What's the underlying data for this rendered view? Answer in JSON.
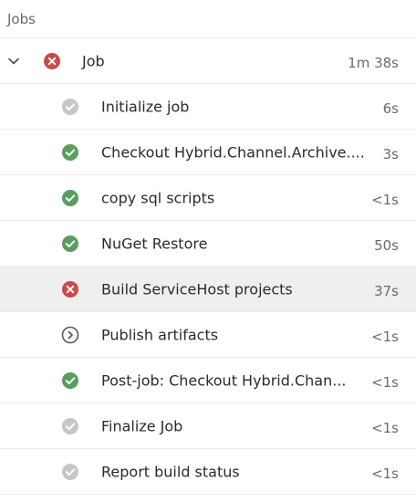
{
  "header": {
    "title": "Jobs"
  },
  "colors": {
    "success": "#5a9e5f",
    "failed": "#c84b4b",
    "skipped": "#c6c6c6",
    "pending_outline": "#5a5a5a",
    "selected_row": "#efefef"
  },
  "job": {
    "label": "Job",
    "duration": "1m 38s",
    "status": "failed",
    "icon": "failed-icon"
  },
  "steps": [
    {
      "label": "Initialize job",
      "duration": "6s",
      "status": "skipped"
    },
    {
      "label": "Checkout Hybrid.Channel.Archive....",
      "duration": "3s",
      "status": "success"
    },
    {
      "label": "copy sql scripts",
      "duration": "<1s",
      "status": "success"
    },
    {
      "label": "NuGet Restore",
      "duration": "50s",
      "status": "success"
    },
    {
      "label": "Build ServiceHost projects",
      "duration": "37s",
      "status": "failed",
      "selected": true
    },
    {
      "label": "Publish artifacts",
      "duration": "<1s",
      "status": "pending"
    },
    {
      "label": "Post-job: Checkout Hybrid.Chan...",
      "duration": "<1s",
      "status": "success"
    },
    {
      "label": "Finalize Job",
      "duration": "<1s",
      "status": "skipped"
    },
    {
      "label": "Report build status",
      "duration": "<1s",
      "status": "skipped"
    }
  ]
}
